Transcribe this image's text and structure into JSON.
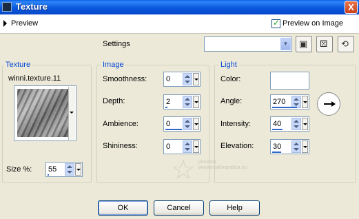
{
  "window": {
    "title": "Texture",
    "close_label": "X"
  },
  "preview": {
    "label": "Preview",
    "preview_on_image_label": "Preview on Image",
    "preview_on_image_checked": true
  },
  "settings": {
    "label": "Settings",
    "value": ""
  },
  "texture": {
    "group_title": "Texture",
    "name": "winni.texture.11",
    "size_label": "Size %:",
    "size_value": "55"
  },
  "image": {
    "group_title": "Image",
    "smoothness_label": "Smoothness:",
    "smoothness_value": "0",
    "depth_label": "Depth:",
    "depth_value": "2",
    "ambience_label": "Ambience:",
    "ambience_value": "0",
    "shininess_label": "Shininess:",
    "shininess_value": "0"
  },
  "light": {
    "group_title": "Light",
    "color_label": "Color:",
    "color_value": "#ffffff",
    "angle_label": "Angle:",
    "angle_value": "270",
    "intensity_label": "Intensity:",
    "intensity_value": "40",
    "elevation_label": "Elevation:",
    "elevation_value": "30"
  },
  "buttons": {
    "ok": "OK",
    "cancel": "Cancel",
    "help": "Help"
  },
  "watermark": {
    "line1": "pinuccia",
    "line2": "www.maidiregrafica.eu"
  },
  "icons": [
    "save-icon",
    "dice-icon",
    "reset-icon"
  ],
  "colors": {
    "titlebar": "#0b58de",
    "group_title": "#0046d5",
    "dialog_bg": "#ece9d8"
  }
}
